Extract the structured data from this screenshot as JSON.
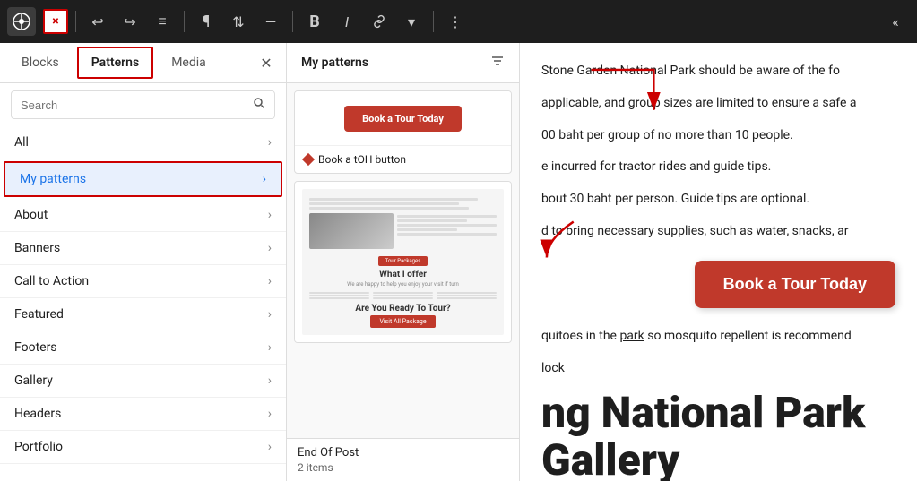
{
  "toolbar": {
    "wp_logo_label": "WordPress",
    "close_btn_label": "×",
    "undo_icon": "↩",
    "redo_icon": "↪",
    "list_view_icon": "≡",
    "paragraph_icon": "¶",
    "arrows_icon": "⇅",
    "line_icon": "—",
    "bold_icon": "B",
    "italic_icon": "I",
    "link_icon": "🔗",
    "dropdown_icon": "▾",
    "more_icon": "⋮",
    "collapse_icon": "«"
  },
  "left_panel": {
    "tabs": [
      {
        "label": "Blocks",
        "active": false
      },
      {
        "label": "Patterns",
        "active": true
      },
      {
        "label": "Media",
        "active": false
      }
    ],
    "search_placeholder": "Search",
    "nav_items": [
      {
        "label": "All",
        "active": false
      },
      {
        "label": "My patterns",
        "active": true
      },
      {
        "label": "About",
        "active": false
      },
      {
        "label": "Banners",
        "active": false
      },
      {
        "label": "Call to Action",
        "active": false
      },
      {
        "label": "Featured",
        "active": false
      },
      {
        "label": "Footers",
        "active": false
      },
      {
        "label": "Gallery",
        "active": false
      },
      {
        "label": "Headers",
        "active": false
      },
      {
        "label": "Portfolio",
        "active": false
      }
    ]
  },
  "patterns_panel": {
    "title": "My patterns",
    "items": [
      {
        "type": "button",
        "preview_label": "Book a Tour Today",
        "label": "Book a tOH button"
      },
      {
        "type": "section",
        "label": "End Of Post"
      }
    ],
    "item_count": "2 items"
  },
  "right_content": {
    "paragraphs": [
      "Stone Garden National Park should be aware of the fo",
      "applicable, and group sizes are limited to ensure a safe a",
      "00 baht per group of no more than 10 people.",
      "e incurred for tractor rides and guide tips.",
      "bout 30 baht per person. Guide tips are optional.",
      "d to bring necessary supplies, such as water, snacks, ar"
    ],
    "cta_button_label": "Book a Tour Today",
    "mosquito_text": "quitoes in the",
    "park_link": "park",
    "mosquito_text2": "so mosquito repellent is recommend",
    "block_text": "lock",
    "heading": "ng National Park Gallery"
  }
}
